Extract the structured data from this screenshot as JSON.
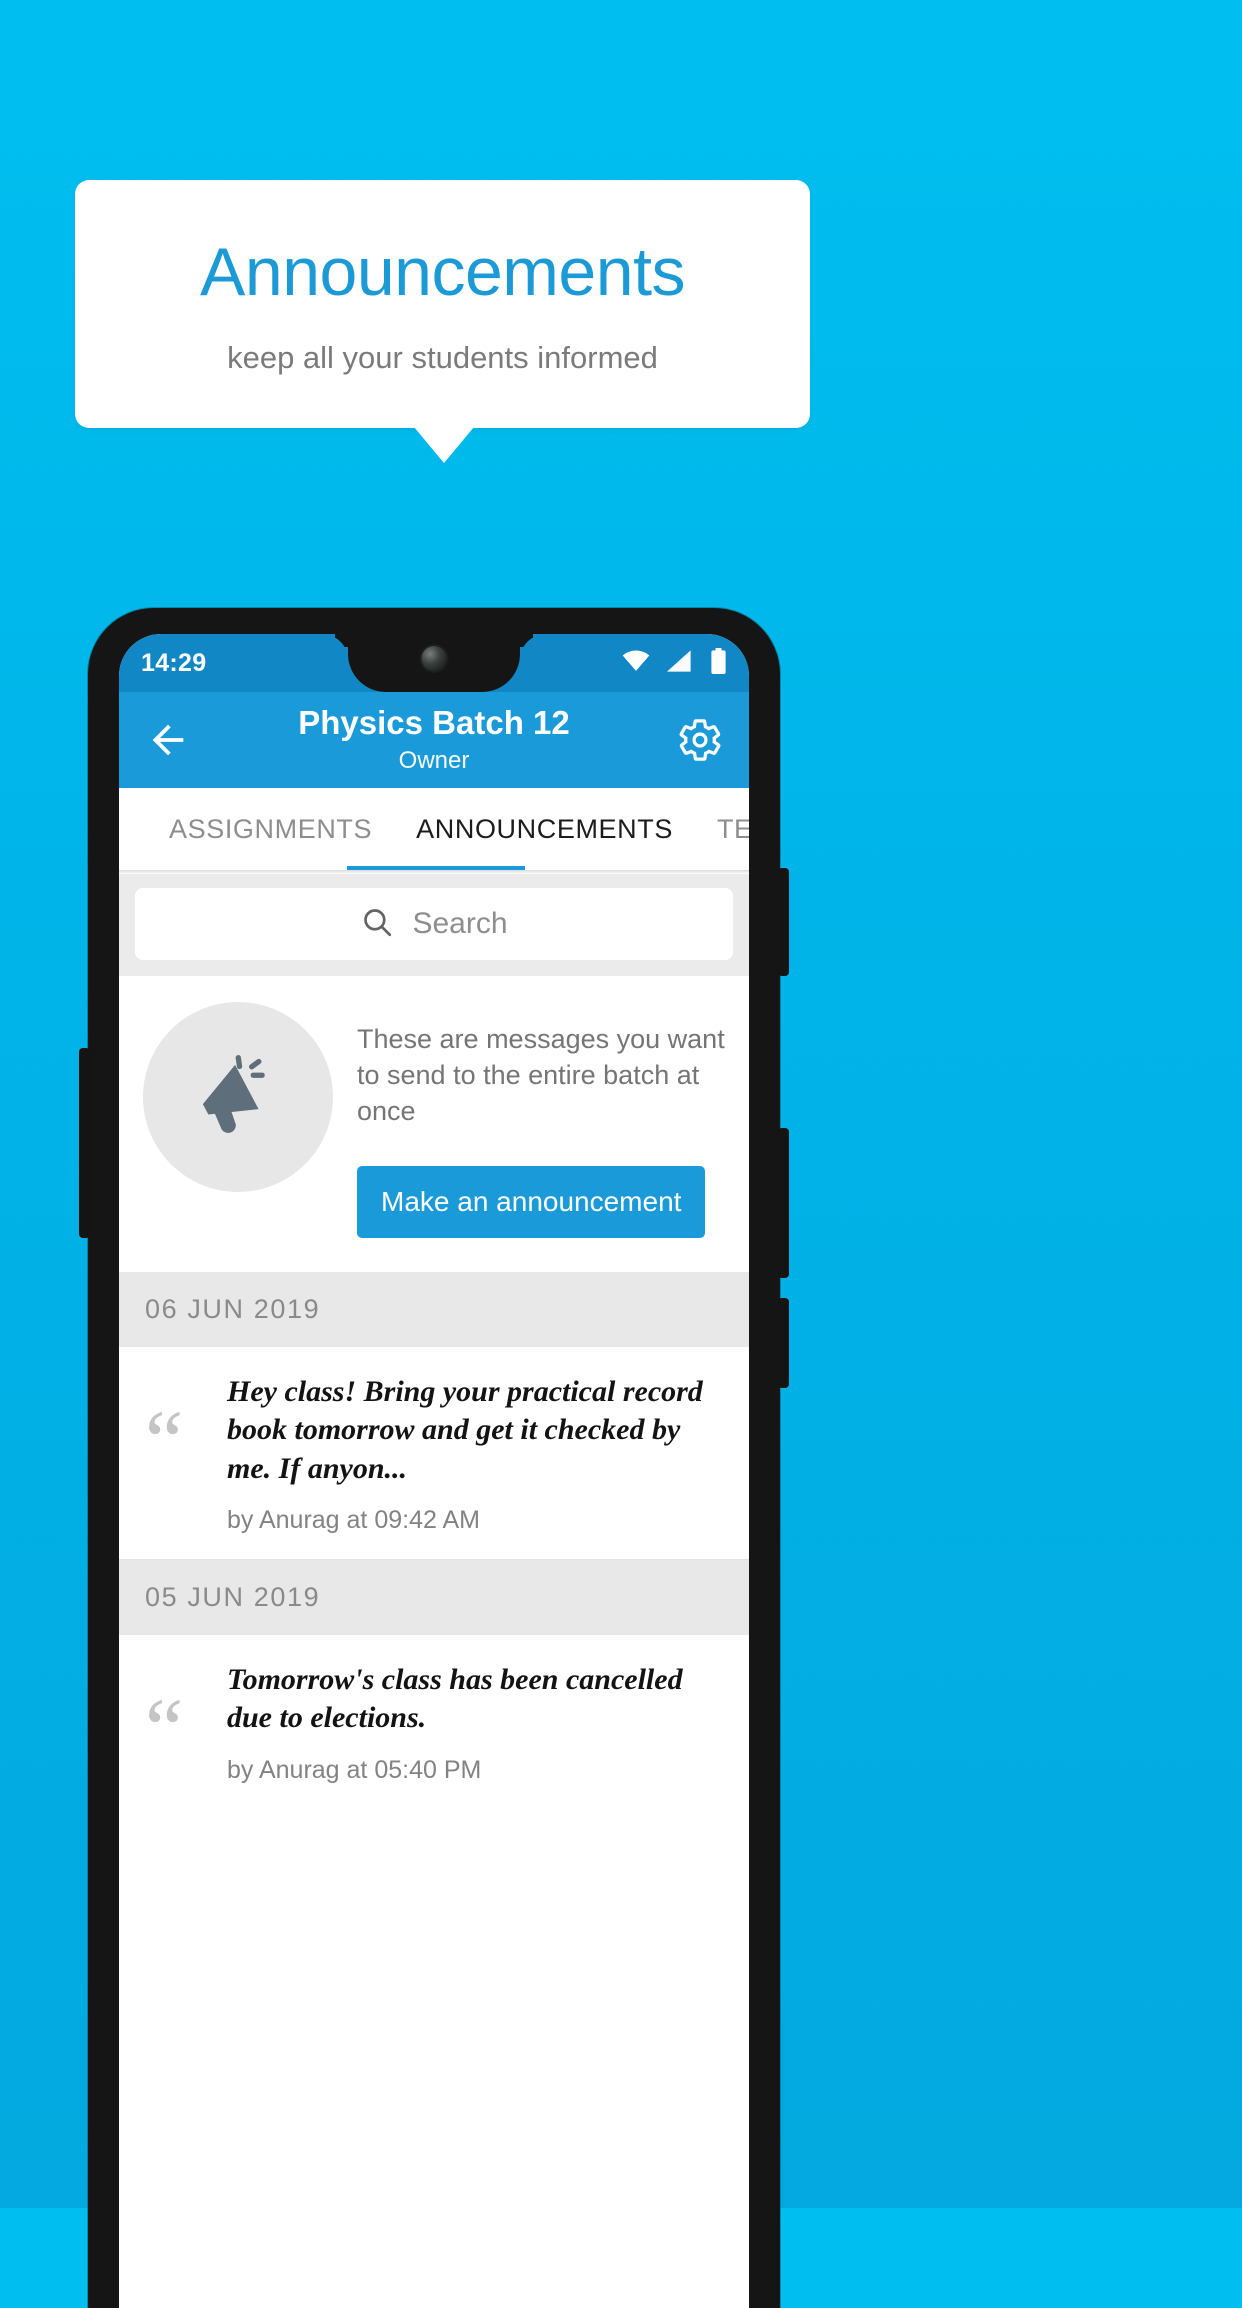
{
  "promo": {
    "title": "Announcements",
    "subtitle": "keep all your students informed",
    "title_color": "#1b9ad6",
    "background_color": "#00b3e8"
  },
  "status_bar": {
    "time": "14:29",
    "icons": [
      "wifi-icon",
      "signal-icon",
      "battery-icon"
    ]
  },
  "app_bar": {
    "back_icon": "back-arrow-icon",
    "title": "Physics Batch 12",
    "subtitle": "Owner",
    "settings_icon": "gear-icon",
    "color": "#1a9ad8"
  },
  "tabs": [
    {
      "label": "ASSIGNMENTS",
      "active": false
    },
    {
      "label": "ANNOUNCEMENTS",
      "active": true
    },
    {
      "label": "TESTS",
      "active": false
    }
  ],
  "search": {
    "icon": "search-icon",
    "placeholder": "Search",
    "value": ""
  },
  "empty_promo": {
    "icon": "megaphone-icon",
    "text": "These are messages you want to send to the entire batch at once",
    "button_label": "Make an announcement"
  },
  "announcement_groups": [
    {
      "date": "06  JUN  2019",
      "items": [
        {
          "quote_icon": "quote-icon",
          "text": "Hey class! Bring your practical record book tomorrow and get it checked by me. If anyon...",
          "meta": "by Anurag at 09:42 AM"
        }
      ]
    },
    {
      "date": "05  JUN  2019",
      "items": [
        {
          "quote_icon": "quote-icon",
          "text": "Tomorrow's class has been cancelled due to elections.",
          "meta": "by Anurag at 05:40 PM"
        }
      ]
    }
  ]
}
